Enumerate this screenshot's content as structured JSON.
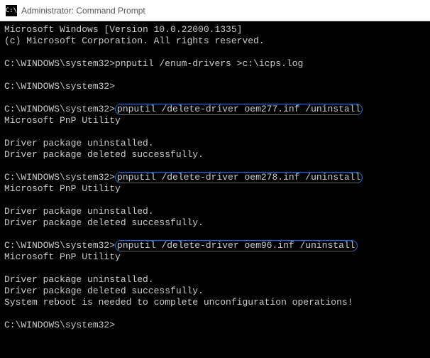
{
  "titlebar": {
    "icon_label": "C:\\",
    "title": "Administrator: Command Prompt"
  },
  "terminal": {
    "lines": [
      {
        "text": "Microsoft Windows [Version 10.0.22000.1335]"
      },
      {
        "text": "(c) Microsoft Corporation. All rights reserved."
      },
      {
        "text": ""
      },
      {
        "prompt": "C:\\WINDOWS\\system32>",
        "cmd": "pnputil /enum-drivers >c:\\icps.log"
      },
      {
        "text": ""
      },
      {
        "prompt": "C:\\WINDOWS\\system32>",
        "cmd": ""
      },
      {
        "text": ""
      },
      {
        "prompt": "C:\\WINDOWS\\system32>",
        "cmd_hl": "pnputil /delete-driver oem277.inf /uninstall"
      },
      {
        "text": "Microsoft PnP Utility"
      },
      {
        "text": ""
      },
      {
        "text": "Driver package uninstalled."
      },
      {
        "text": "Driver package deleted successfully."
      },
      {
        "text": ""
      },
      {
        "prompt": "C:\\WINDOWS\\system32>",
        "cmd_hl": "pnputil /delete-driver oem278.inf /uninstall"
      },
      {
        "text": "Microsoft PnP Utility"
      },
      {
        "text": ""
      },
      {
        "text": "Driver package uninstalled."
      },
      {
        "text": "Driver package deleted successfully."
      },
      {
        "text": ""
      },
      {
        "prompt": "C:\\WINDOWS\\system32>",
        "cmd_hl": "pnputil /delete-driver oem96.inf /uninstall"
      },
      {
        "text": "Microsoft PnP Utility"
      },
      {
        "text": ""
      },
      {
        "text": "Driver package uninstalled."
      },
      {
        "text": "Driver package deleted successfully."
      },
      {
        "text": "System reboot is needed to complete unconfiguration operations!"
      },
      {
        "text": ""
      },
      {
        "prompt": "C:\\WINDOWS\\system32>",
        "cmd": ""
      }
    ]
  }
}
